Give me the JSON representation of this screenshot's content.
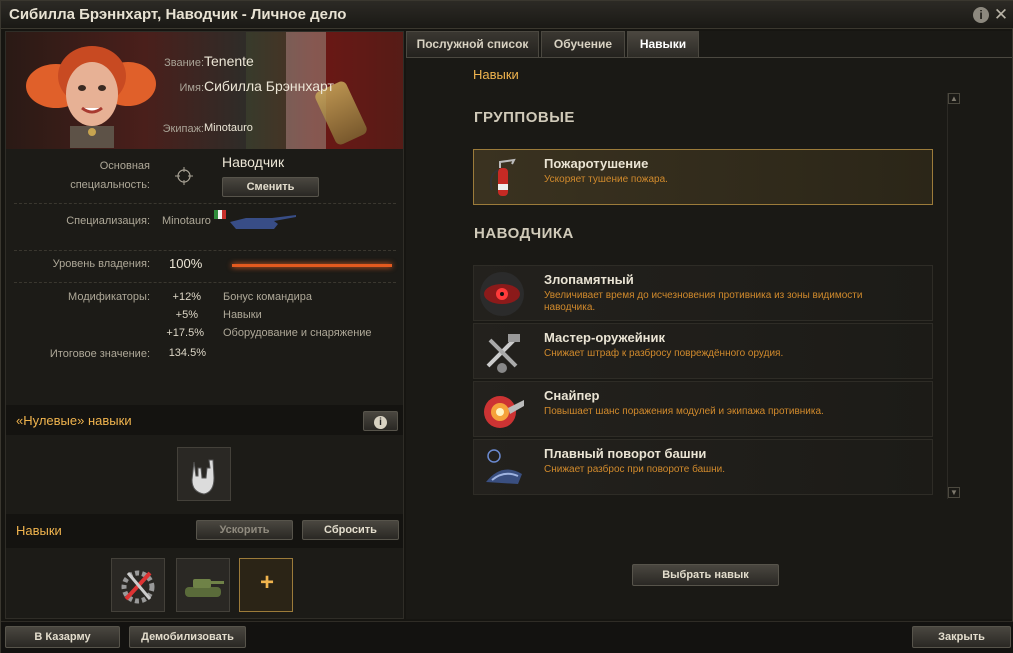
{
  "window": {
    "title": "Сибилла Брэннхарт, Наводчик - Личное дело",
    "info_icon": "info-icon",
    "close_icon": "close-icon"
  },
  "profile": {
    "rank_label": "Звание:",
    "rank": "Tenente",
    "name_label": "Имя:",
    "name": "Сибилла Брэннхарт",
    "crew_label": "Экипаж:",
    "crew": "Minotauro"
  },
  "specialty": {
    "label1": "Основная",
    "label2": "специальность:",
    "value": "Наводчик",
    "change_button": "Сменить"
  },
  "specialization": {
    "label": "Специализация:",
    "vehicle": "Minotauro",
    "flag": "italy-flag"
  },
  "proficiency": {
    "label": "Уровень владения:",
    "value": "100%",
    "level": 1.0
  },
  "modifiers": {
    "label": "Модификаторы:",
    "rows": [
      {
        "value": "+12%",
        "name": "Бонус командира"
      },
      {
        "value": "+5%",
        "name": "Навыки"
      },
      {
        "value": "+17.5%",
        "name": "Оборудование и снаряжение"
      }
    ],
    "total_label": "Итоговое значение:",
    "total_value": "134.5%"
  },
  "zero_skills": {
    "title": "«Нулевые» навыки",
    "icon": "rock-hand-icon"
  },
  "skills_section": {
    "title": "Навыки",
    "accelerate_button": "Ускорить",
    "reset_button": "Сбросить",
    "slots": [
      "repair-tools-icon",
      "tank-icon",
      "add-skill-slot"
    ],
    "add_symbol": "+"
  },
  "tabs": [
    {
      "label": "Послужной список",
      "active": false
    },
    {
      "label": "Обучение",
      "active": false
    },
    {
      "label": "Навыки",
      "active": true
    }
  ],
  "skills_view": {
    "breadcrumb": "Навыки",
    "groups": [
      {
        "title": "ГРУППОВЫЕ",
        "skills": [
          {
            "title": "Пожаротушение",
            "desc": "Ускоряет тушение пожара.",
            "icon": "fire-extinguisher-icon",
            "selected": true
          }
        ]
      },
      {
        "title": "НАВОДЧИКА",
        "skills": [
          {
            "title": "Злопамятный",
            "desc": "Увеличивает время до исчезновения противника из зоны видимости наводчика.",
            "icon": "evil-eye-icon",
            "selected": false
          },
          {
            "title": "Мастер-оружейник",
            "desc": "Снижает штраф к разбросу повреждённого орудия.",
            "icon": "armorer-icon",
            "selected": false
          },
          {
            "title": "Снайпер",
            "desc": "Повышает шанс поражения модулей и экипажа противника.",
            "icon": "sniper-icon",
            "selected": false
          },
          {
            "title": "Плавный поворот башни",
            "desc": "Снижает разброс при повороте башни.",
            "icon": "turret-rotation-icon",
            "selected": false
          }
        ]
      }
    ],
    "choose_button": "Выбрать навык",
    "scroll_up": "▲",
    "scroll_down": "▼"
  },
  "footer": {
    "barracks_button": "В Казарму",
    "demobilize_button": "Демобилизовать",
    "close_button": "Закрыть"
  },
  "colors": {
    "accent": "#f0b44e",
    "desc": "#d18a2c",
    "bar": "#e35a1f"
  }
}
